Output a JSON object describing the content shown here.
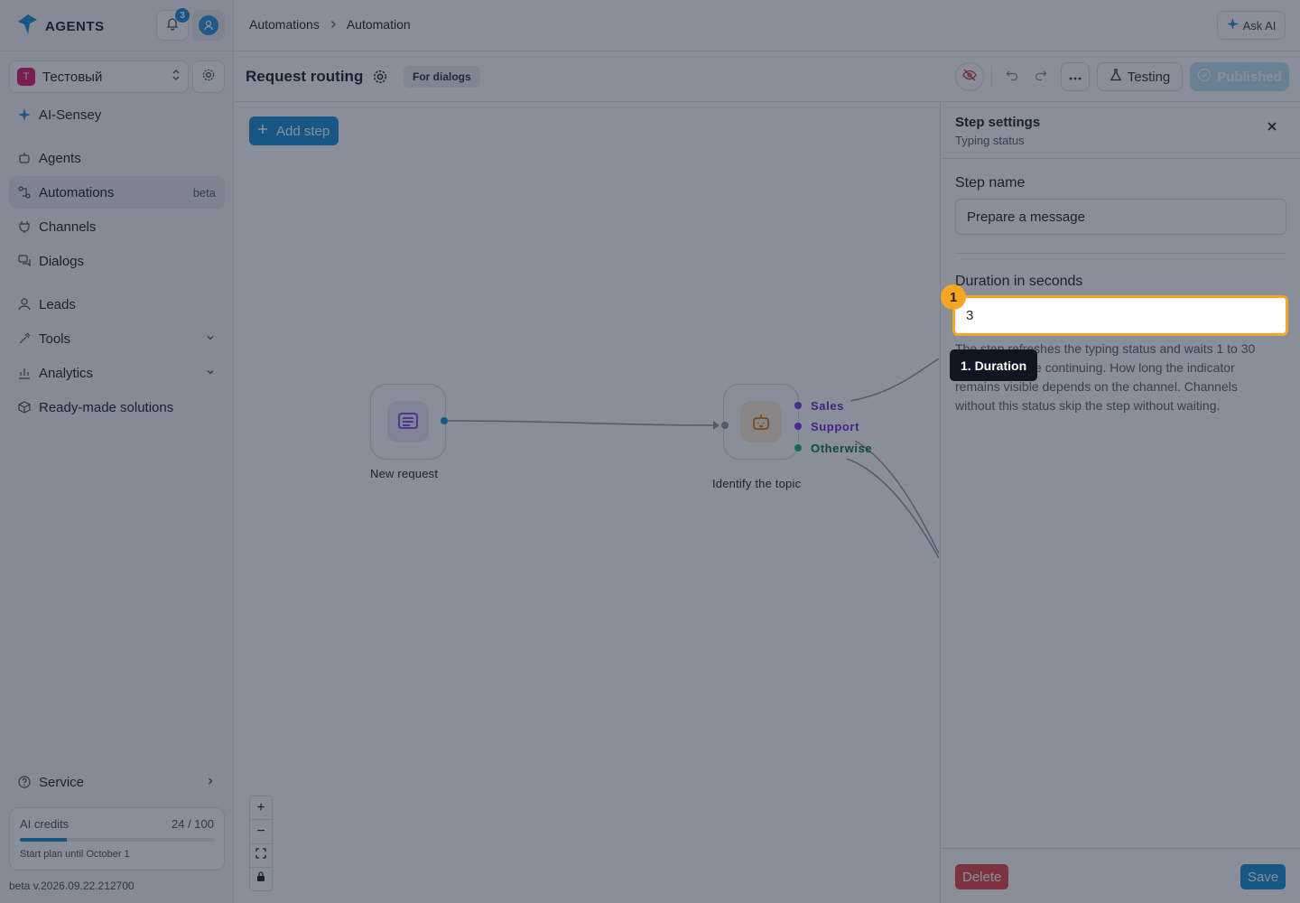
{
  "brand": {
    "name": "AGENTS"
  },
  "notifications": {
    "count": "3"
  },
  "workspace": {
    "letter": "T",
    "name": "Тестовый"
  },
  "nav": {
    "ai_item": "AI-Sensey",
    "items": [
      {
        "label": "Agents",
        "icon": "agents-icon"
      },
      {
        "label": "Automations",
        "icon": "automations-icon",
        "badge": "beta",
        "active": true
      },
      {
        "label": "Channels",
        "icon": "plug-icon"
      },
      {
        "label": "Dialogs",
        "icon": "chat-icon"
      },
      {
        "label": "Leads",
        "icon": "person-icon"
      },
      {
        "label": "Tools",
        "icon": "tools-icon"
      },
      {
        "label": "Analytics",
        "icon": "chart-icon"
      },
      {
        "label": "Ready-made solutions",
        "icon": "box-icon"
      }
    ],
    "service": "Service"
  },
  "credits": {
    "label": "AI credits",
    "value": "24 / 100",
    "used": 24,
    "total": 100,
    "plan": "Start plan until October 1"
  },
  "version": "beta v.2026.09.22.212700",
  "breadcrumb": {
    "root": "Automations",
    "current": "Automation"
  },
  "ask_ai": "Ask AI",
  "toolbar": {
    "title": "Request routing",
    "tag": "For dialogs",
    "testing": "Testing",
    "published": "Published"
  },
  "canvas": {
    "add_step": "Add step",
    "nodes": {
      "new_request": "New request",
      "identify_topic": "Identify the topic"
    },
    "branches": [
      "Sales",
      "Support",
      "Otherwise"
    ]
  },
  "panel": {
    "title": "Step settings",
    "subtitle": "Typing status",
    "step_name_label": "Step name",
    "step_name_value": "Prepare a message",
    "duration_label": "Duration in seconds",
    "duration_value": "3",
    "hint": "The step refreshes the typing status and waits 1 to 30 seconds before continuing. How long the indicator remains visible depends on the channel. Channels without this status skip the step without waiting.",
    "delete": "Delete",
    "save": "Save"
  },
  "annotation": {
    "badge": "1",
    "tooltip": "1. Duration"
  },
  "colors": {
    "accent": "#1d8fd9",
    "highlight": "#f5a623",
    "danger": "#e34a4a",
    "sales": "#7c3aed",
    "otherwise": "#10b981"
  }
}
